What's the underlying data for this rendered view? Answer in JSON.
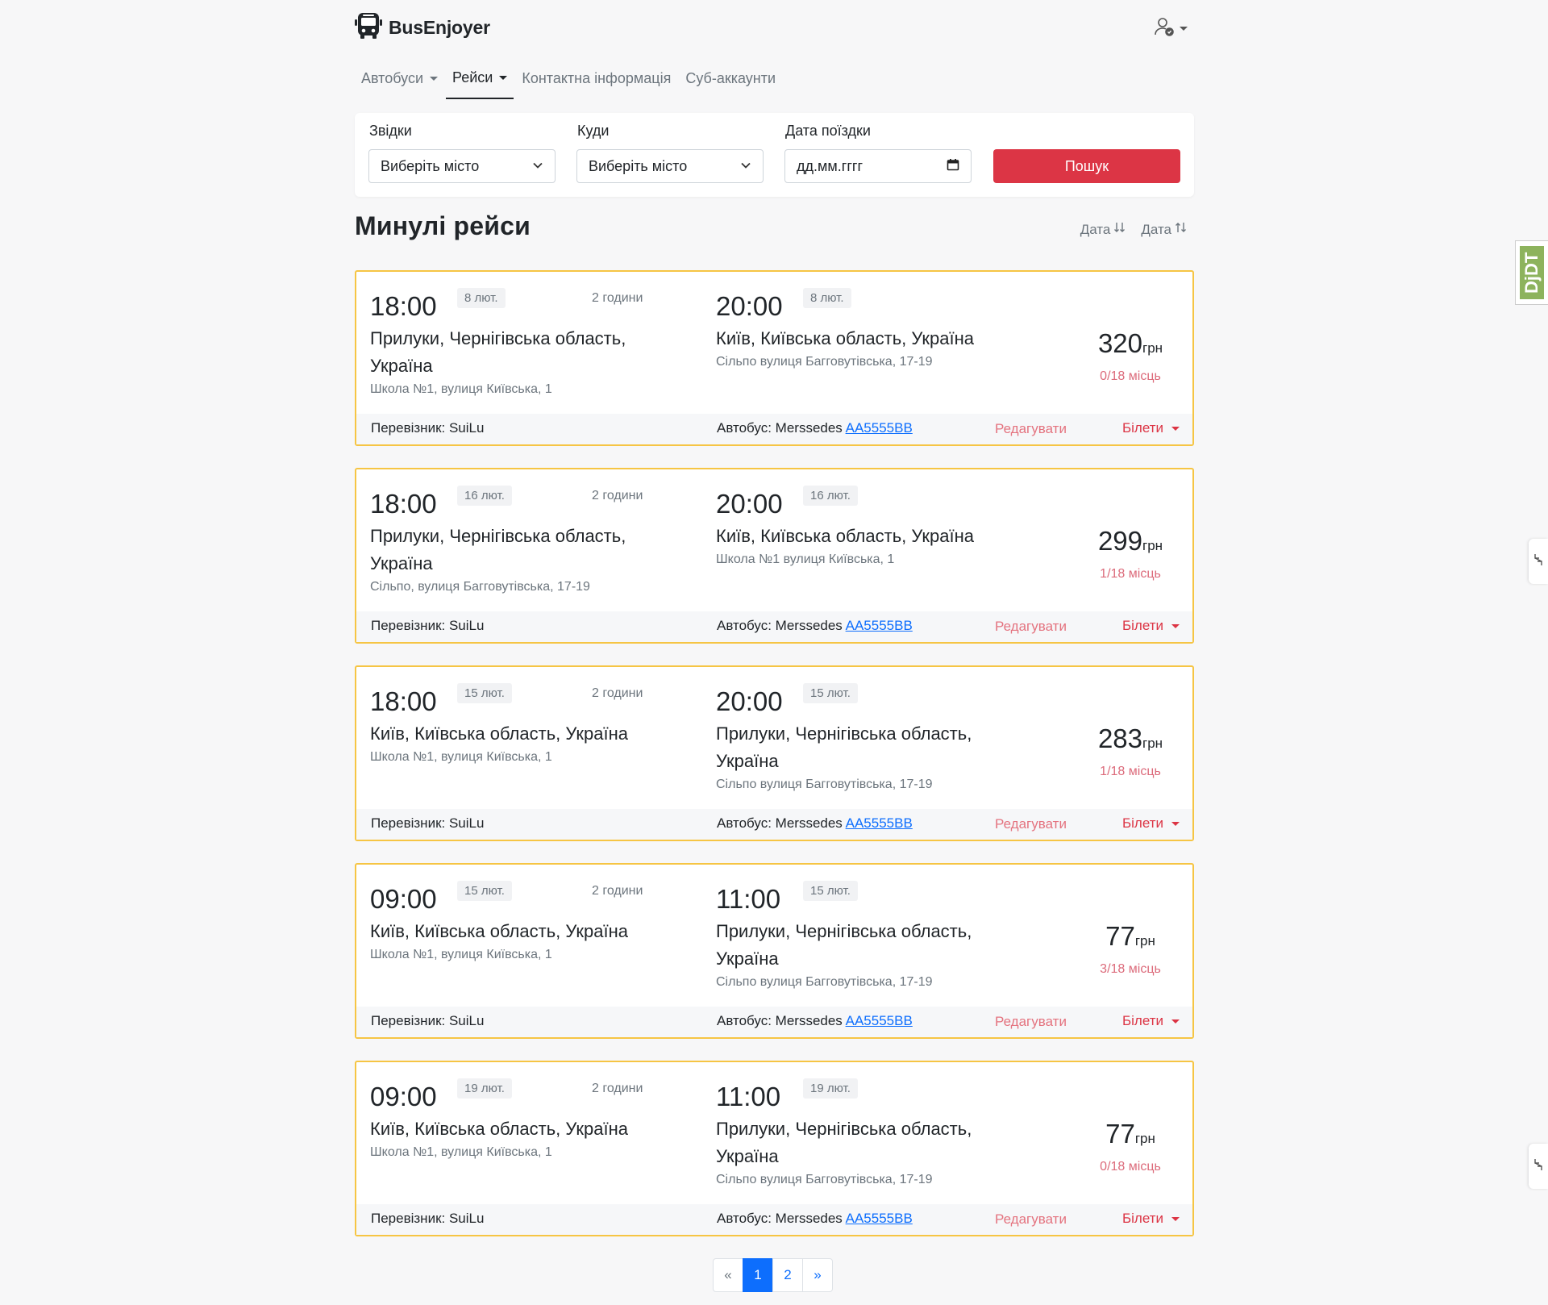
{
  "brand": {
    "name": "BusEnjoyer"
  },
  "nav": [
    {
      "label": "Автобуси"
    },
    {
      "label": "Рейси"
    },
    {
      "label": "Контактна інформація"
    },
    {
      "label": "Суб-аккаунти"
    }
  ],
  "search": {
    "from_label": "Звідки",
    "from_value": "Виберіть місто",
    "to_label": "Куди",
    "to_value": "Виберіть місто",
    "date_label": "Дата поїздки",
    "date_placeholder": "дд.мм.гггг",
    "button_label": "Пошук"
  },
  "section": {
    "title": "Минулі рейси",
    "sort_desc": "Дата",
    "sort_asc": "Дата"
  },
  "trips": [
    {
      "dep_time": "18:00",
      "dep_date": "8 лют.",
      "duration": "2 години",
      "dep_city": "Прилуки, Чернігівська область, Україна",
      "dep_addr": "Школа №1, вулиця Київська, 1",
      "arr_time": "20:00",
      "arr_date": "8 лют.",
      "arr_city": "Київ, Київська область, Україна",
      "arr_addr": "Сільпо вулиця Багговутівська, 17-19",
      "price": "320",
      "currency": "грн",
      "seats": "0/18 місць",
      "carrier": "Перевізник: SuiLu",
      "bus_label": "Автобус: Merssedes",
      "plate": "AA5555BB",
      "edit": "Редагувати",
      "tickets": "Білети"
    },
    {
      "dep_time": "18:00",
      "dep_date": "16 лют.",
      "duration": "2 години",
      "dep_city": "Прилуки, Чернігівська область, Україна",
      "dep_addr": "Сільпо, вулиця Багговутівська, 17-19",
      "arr_time": "20:00",
      "arr_date": "16 лют.",
      "arr_city": "Київ, Київська область, Україна",
      "arr_addr": "Школа №1 вулиця Київська, 1",
      "price": "299",
      "currency": "грн",
      "seats": "1/18 місць",
      "carrier": "Перевізник: SuiLu",
      "bus_label": "Автобус: Merssedes",
      "plate": "AA5555BB",
      "edit": "Редагувати",
      "tickets": "Білети"
    },
    {
      "dep_time": "18:00",
      "dep_date": "15 лют.",
      "duration": "2 години",
      "dep_city": "Київ, Київська область, Україна",
      "dep_addr": "Школа №1, вулиця Київська, 1",
      "arr_time": "20:00",
      "arr_date": "15 лют.",
      "arr_city": "Прилуки, Чернігівська область, Україна",
      "arr_addr": "Сільпо вулиця Багговутівська, 17-19",
      "price": "283",
      "currency": "грн",
      "seats": "1/18 місць",
      "carrier": "Перевізник: SuiLu",
      "bus_label": "Автобус: Merssedes",
      "plate": "AA5555BB",
      "edit": "Редагувати",
      "tickets": "Білети"
    },
    {
      "dep_time": "09:00",
      "dep_date": "15 лют.",
      "duration": "2 години",
      "dep_city": "Київ, Київська область, Україна",
      "dep_addr": "Школа №1, вулиця Київська, 1",
      "arr_time": "11:00",
      "arr_date": "15 лют.",
      "arr_city": "Прилуки, Чернігівська область, Україна",
      "arr_addr": "Сільпо вулиця Багговутівська, 17-19",
      "price": "77",
      "currency": "грн",
      "seats": "3/18 місць",
      "carrier": "Перевізник: SuiLu",
      "bus_label": "Автобус: Merssedes",
      "plate": "AA5555BB",
      "edit": "Редагувати",
      "tickets": "Білети"
    },
    {
      "dep_time": "09:00",
      "dep_date": "19 лют.",
      "duration": "2 години",
      "dep_city": "Київ, Київська область, Україна",
      "dep_addr": "Школа №1, вулиця Київська, 1",
      "arr_time": "11:00",
      "arr_date": "19 лют.",
      "arr_city": "Прилуки, Чернігівська область, Україна",
      "arr_addr": "Сільпо вулиця Багговутівська, 17-19",
      "price": "77",
      "currency": "грн",
      "seats": "0/18 місць",
      "carrier": "Перевізник: SuiLu",
      "bus_label": "Автобус: Merssedes",
      "plate": "AA5555BB",
      "edit": "Редагувати",
      "tickets": "Білети"
    }
  ],
  "pagination": {
    "prev": "«",
    "pages": [
      "1",
      "2"
    ],
    "next": "»",
    "current": "1"
  },
  "debug_toolbar": {
    "label": "DjDT"
  },
  "colors": {
    "accent": "#dc3545",
    "card_border": "#f6c544",
    "link": "#0d6efd"
  },
  "icons": [
    "bus-icon",
    "user-check-icon",
    "chevron-down-icon",
    "calendar-icon",
    "sort-desc-icon",
    "sort-asc-icon",
    "caret-down-icon"
  ]
}
